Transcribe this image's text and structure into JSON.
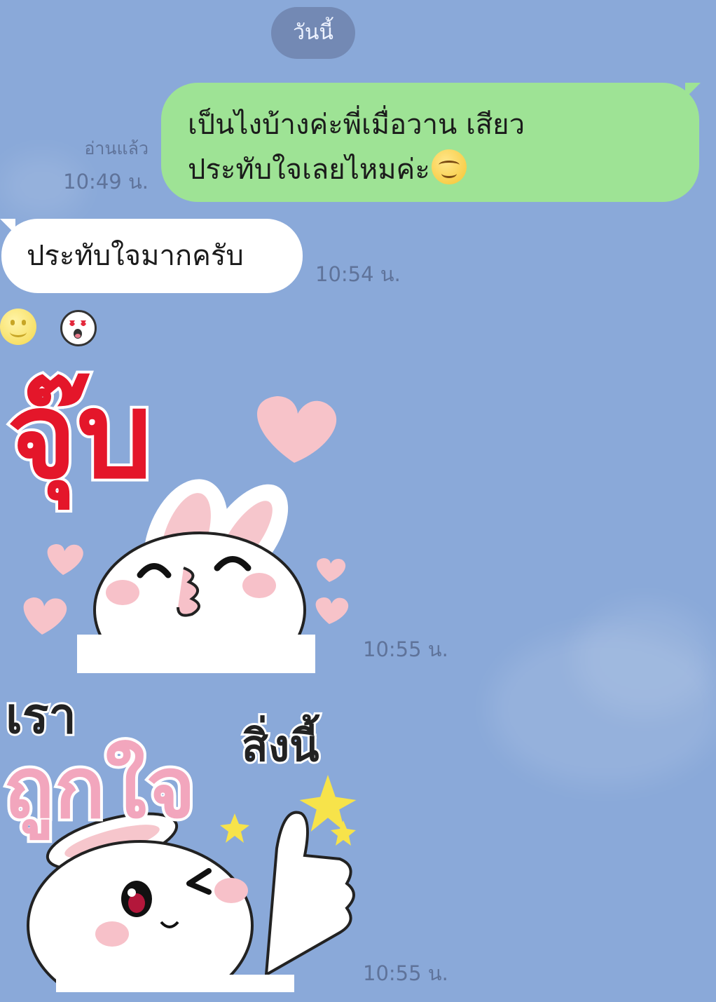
{
  "header": {
    "date_chip": "วันนี้"
  },
  "messages": {
    "outgoing_1": {
      "line1": "เป็นไงบ้างค่ะพี่เมื่อวาน เสียว",
      "line2": "ประทับใจเลยไหมค่ะ",
      "emoji": "smiling-face-icon",
      "read_status": "อ่านแล้ว",
      "time": "10:49 น."
    },
    "incoming_1": {
      "text": "ประทับใจมากครับ",
      "time": "10:54 น."
    },
    "reactions": [
      "smile-reaction-icon",
      "heart-eyes-reaction-icon"
    ],
    "sticker_1": {
      "text": "จุ๊บ",
      "time": "10:55 น."
    },
    "sticker_2": {
      "text_top": "เรา",
      "text_main": "ถูกใจ",
      "text_side": "สิ่งนี้",
      "time": "10:55 น."
    }
  },
  "colors": {
    "background": "#8aa9d9",
    "outgoing_bubble": "#9ee395",
    "incoming_bubble": "#ffffff",
    "timestamp": "#5f739a"
  }
}
